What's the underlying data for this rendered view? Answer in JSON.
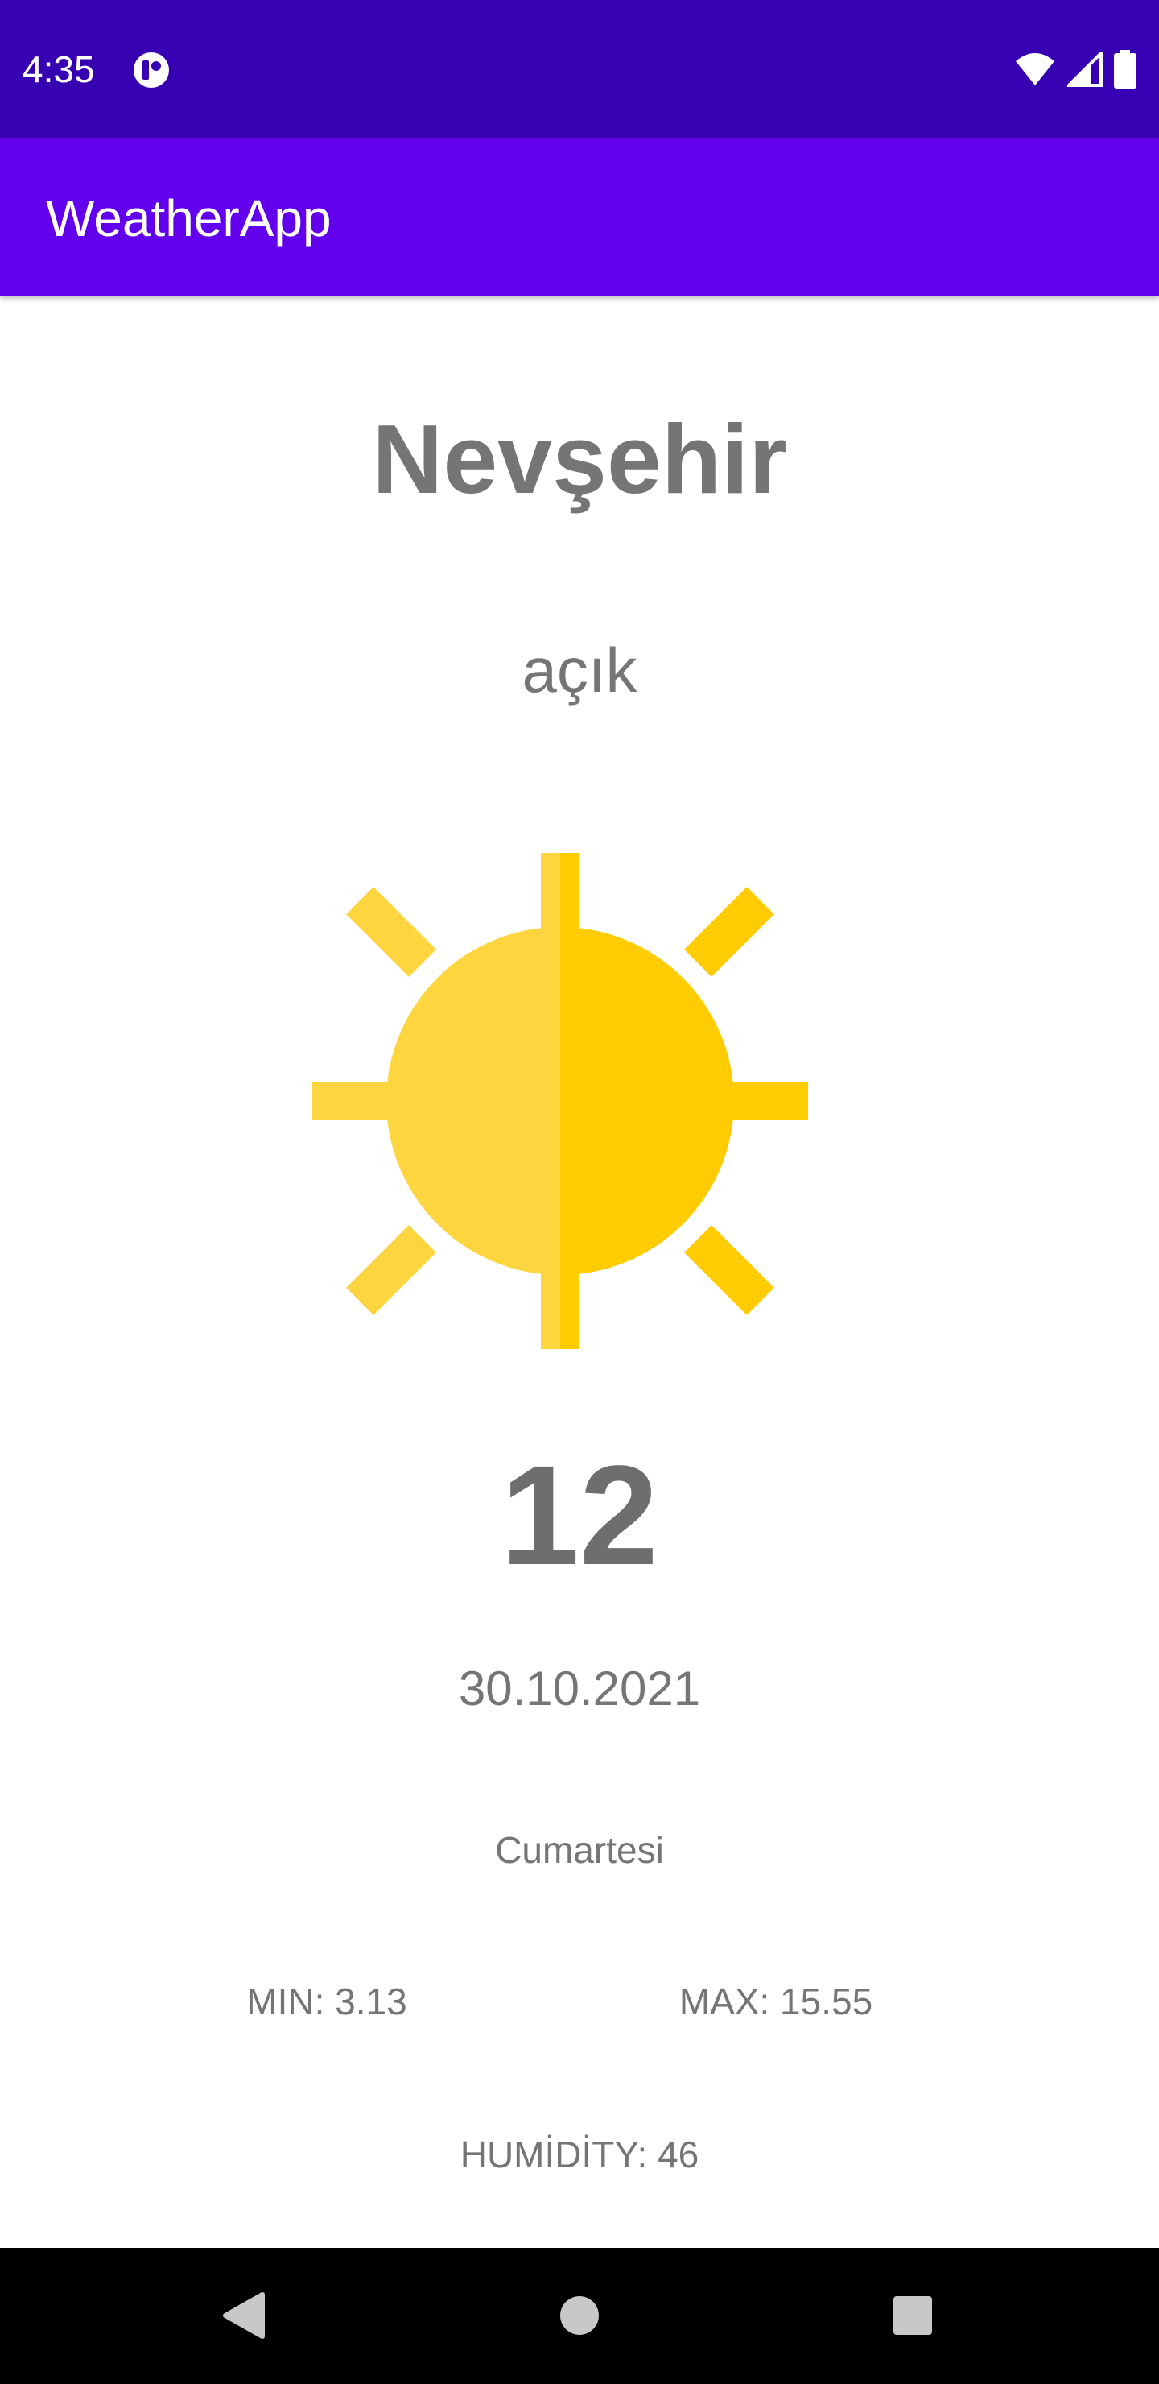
{
  "status_bar": {
    "time": "4:35",
    "icons": [
      "app-notification-icon",
      "wifi-icon",
      "cellular-signal-icon",
      "battery-icon"
    ]
  },
  "app_bar": {
    "title": "WeatherApp"
  },
  "weather": {
    "city": "Nevşehir",
    "condition": "açık",
    "icon": "sun-icon",
    "temperature": "12",
    "date": "30.10.2021",
    "day": "Cumartesi",
    "min": "MIN: 3.13",
    "max": "MAX: 15.55",
    "humidity": "HUMİDİTY: 46"
  },
  "nav_bar": {
    "icons": [
      "back-icon",
      "home-icon",
      "recents-icon"
    ]
  },
  "colors": {
    "status_bar": "#3700b3",
    "app_bar": "#6200ee",
    "text": "#757575",
    "sun_light": "#fdd63f",
    "sun_dark": "#fecc00"
  }
}
